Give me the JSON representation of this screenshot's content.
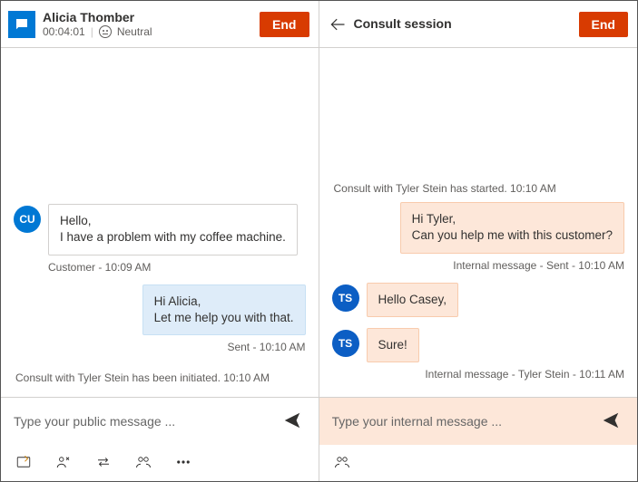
{
  "left": {
    "header": {
      "name": "Alicia Thomber",
      "timer": "00:04:01",
      "sentiment": "Neutral",
      "end_label": "End"
    },
    "messages": {
      "customer_text": "Hello,\nI have a problem with my coffee machine.",
      "customer_meta": "Customer - 10:09 AM",
      "customer_initials": "CU",
      "agent_text": "Hi Alicia,\nLet me help you with that.",
      "agent_meta": "Sent - 10:10 AM",
      "consult_started": "Consult with Tyler Stein has been initiated. 10:10 AM"
    },
    "composer": {
      "placeholder": "Type your public message ..."
    }
  },
  "right": {
    "header": {
      "title": "Consult session",
      "end_label": "End"
    },
    "messages": {
      "started": "Consult with Tyler Stein has started. 10:10 AM",
      "out_text": "Hi Tyler,\nCan you help me with this customer?",
      "out_meta": "Internal message - Sent - 10:10 AM",
      "ts_initials": "TS",
      "in1_text": "Hello Casey,",
      "in2_text": "Sure!",
      "in_meta": "Internal message - Tyler Stein - 10:11 AM"
    },
    "composer": {
      "placeholder": "Type your internal message ..."
    }
  }
}
